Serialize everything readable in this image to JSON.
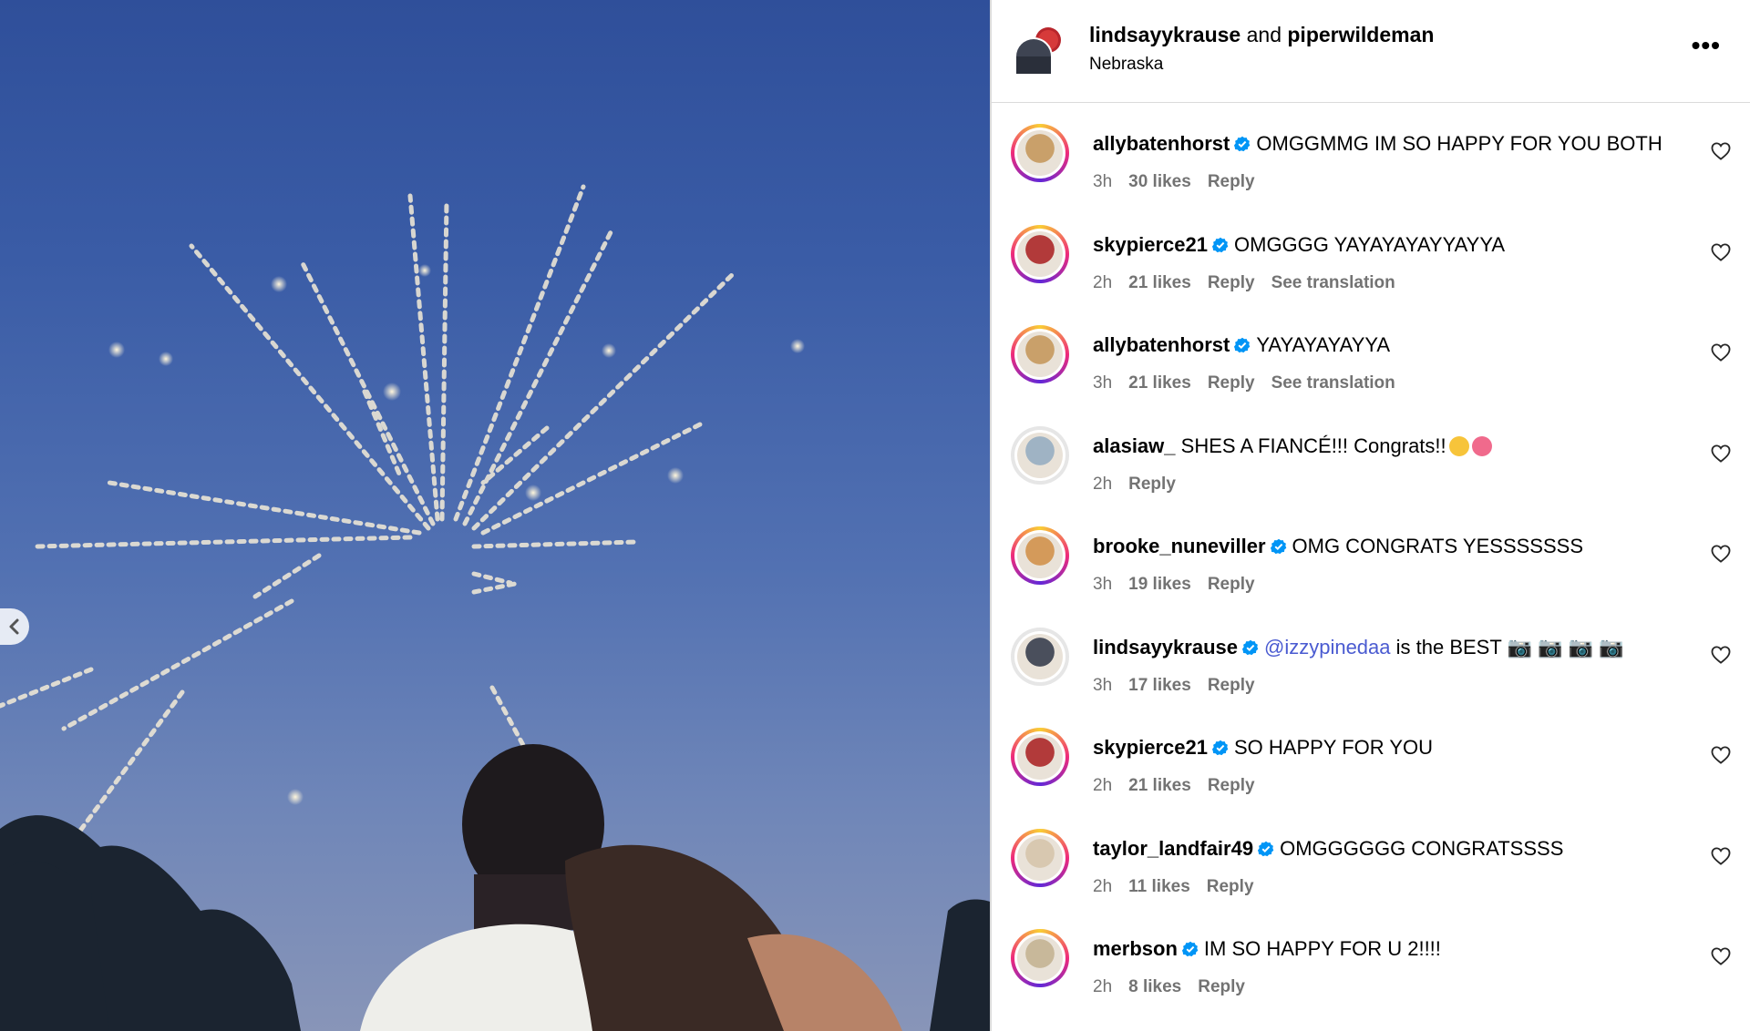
{
  "post": {
    "author_primary": "lindsayykrause",
    "and_text": "and",
    "author_secondary": "piperwildeman",
    "location": "Nebraska",
    "more_label": "•••",
    "prev_icon": "chevron-left-icon"
  },
  "comments": [
    {
      "user": "allybatenhorst",
      "verified": true,
      "text": "OMGGMMG IM SO HAPPY FOR YOU BOTH",
      "time": "3h",
      "likes": "30 likes",
      "reply": "Reply",
      "translation": "",
      "ring": true,
      "avatar_color": "#c9a06a"
    },
    {
      "user": "skypierce21",
      "verified": true,
      "text": "OMGGGG YAYAYAYAYYAYYA",
      "time": "2h",
      "likes": "21 likes",
      "reply": "Reply",
      "translation": "See translation",
      "ring": true,
      "avatar_color": "#b23a3a"
    },
    {
      "user": "allybatenhorst",
      "verified": true,
      "text": "YAYAYAYAYYA",
      "time": "3h",
      "likes": "21 likes",
      "reply": "Reply",
      "translation": "See translation",
      "ring": true,
      "avatar_color": "#c9a06a"
    },
    {
      "user": "alasiaw_",
      "verified": false,
      "text": "SHES A FIANCÉ!!! Congrats!!",
      "time": "2h",
      "likes": "",
      "reply": "Reply",
      "translation": "",
      "ring": false,
      "avatar_color": "#9fb3c4",
      "emojis": [
        "#f7c43a",
        "#f06a8c"
      ]
    },
    {
      "user": "brooke_nuneviller",
      "verified": true,
      "text": "OMG CONGRATS YESSSSSSS",
      "time": "3h",
      "likes": "19 likes",
      "reply": "Reply",
      "translation": "",
      "ring": true,
      "avatar_color": "#d49a5a"
    },
    {
      "user": "lindsayykrause",
      "verified": true,
      "mention": "@izzypinedaa",
      "text": " is the BEST 📷 📷 📷 📷",
      "time": "3h",
      "likes": "17 likes",
      "reply": "Reply",
      "translation": "",
      "ring": false,
      "avatar_color": "#4a4f5c"
    },
    {
      "user": "skypierce21",
      "verified": true,
      "text": "SO HAPPY FOR YOU",
      "time": "2h",
      "likes": "21 likes",
      "reply": "Reply",
      "translation": "",
      "ring": true,
      "avatar_color": "#b23a3a"
    },
    {
      "user": "taylor_landfair49",
      "verified": true,
      "text": "OMGGGGGG CONGRATSSSS",
      "time": "2h",
      "likes": "11 likes",
      "reply": "Reply",
      "translation": "",
      "ring": true,
      "avatar_color": "#d8c8b0"
    },
    {
      "user": "merbson",
      "verified": true,
      "text": "IM SO HAPPY FOR U 2!!!!",
      "time": "2h",
      "likes": "8 likes",
      "reply": "Reply",
      "translation": "",
      "ring": true,
      "avatar_color": "#c8b89a"
    }
  ],
  "colors": {
    "verified": "#0095f6",
    "mention": "#4a5bd1",
    "meta": "#737373",
    "sky_top": "#2f4f9a",
    "sky_bottom": "#8895b8"
  }
}
